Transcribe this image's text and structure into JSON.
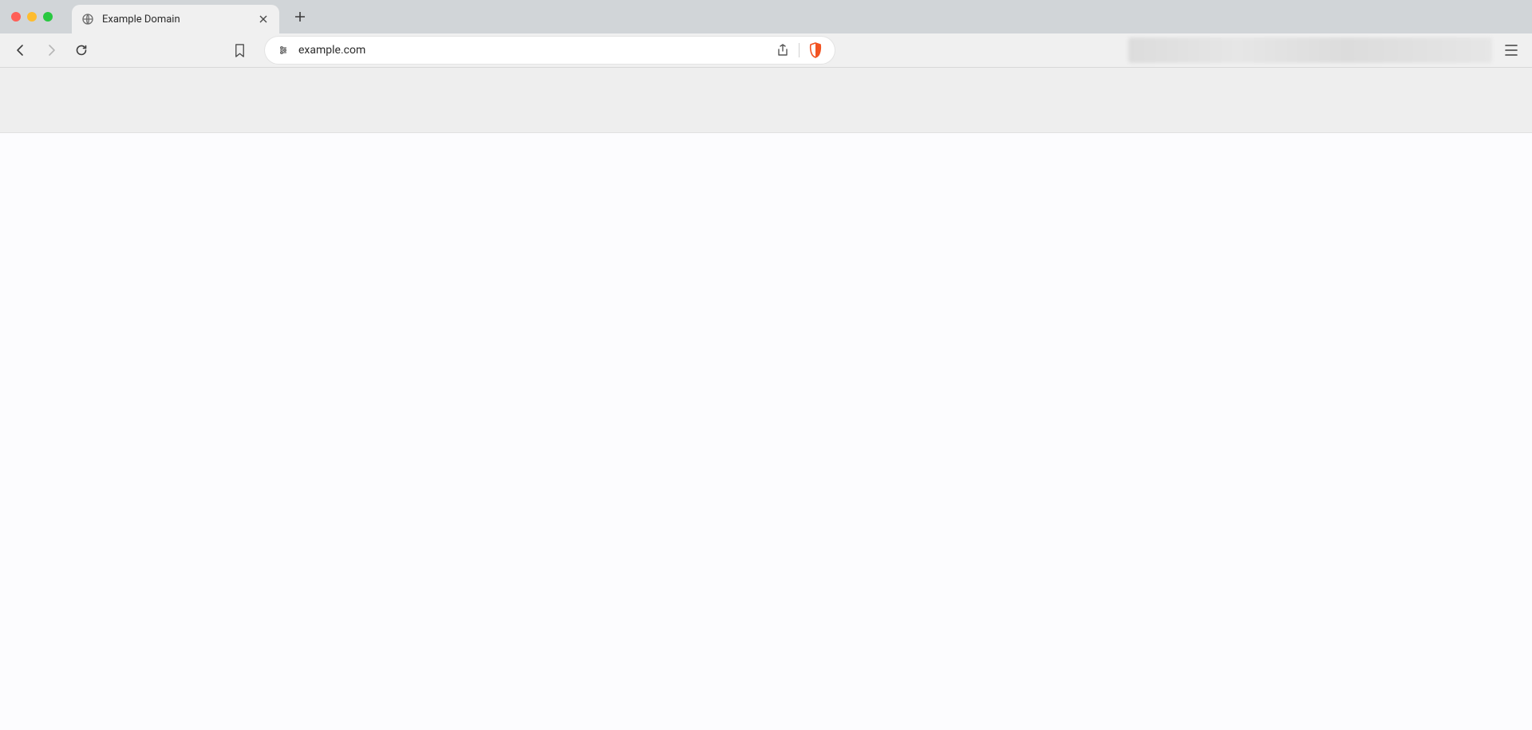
{
  "tab": {
    "title": "Example Domain"
  },
  "toolbar": {
    "url": "example.com"
  },
  "icons": {
    "globe": "globe-icon",
    "close": "close-icon",
    "plus": "plus-icon",
    "back": "back-icon",
    "forward": "forward-icon",
    "reload": "reload-icon",
    "bookmark": "bookmark-icon",
    "site_identity": "site-settings-icon",
    "share": "share-icon",
    "shield": "brave-shield-icon",
    "hamburger": "hamburger-icon"
  },
  "colors": {
    "traffic_close": "#ff5f57",
    "traffic_min": "#febc2e",
    "traffic_zoom": "#28c840",
    "shield_accent": "#f25322"
  }
}
